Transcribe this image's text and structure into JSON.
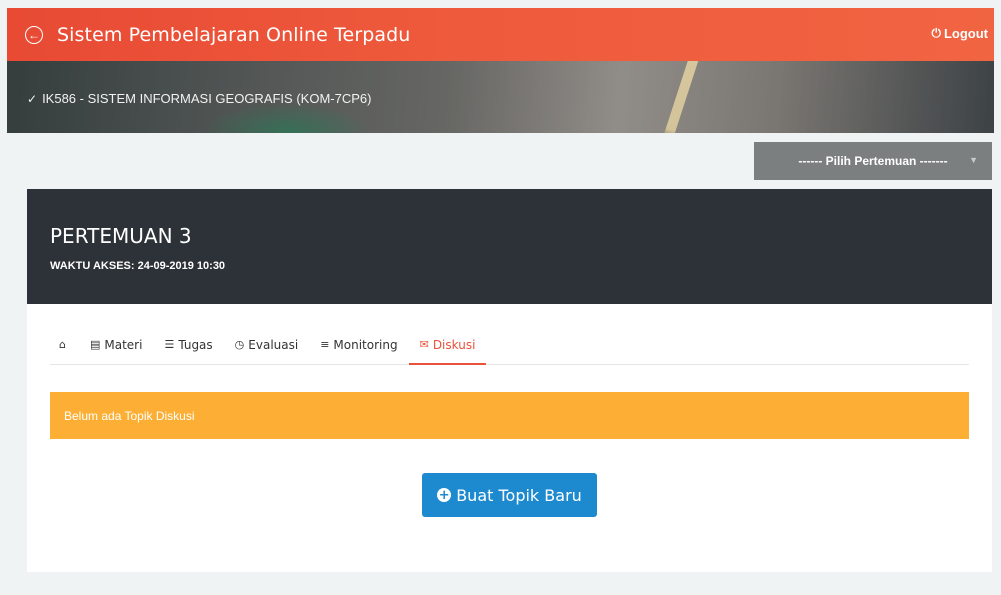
{
  "header": {
    "app_title": "Sistem Pembelajaran Online Terpadu",
    "back_icon": "circle-arrow-left-icon",
    "logout_label": "Logout",
    "logout_icon": "power-icon",
    "brand_color": "#ee5a3c"
  },
  "banner": {
    "course_title": "IK586 - SISTEM INFORMASI GEOGRAFIS (KOM-7CP6)",
    "course_icon": "check-circle-icon"
  },
  "meeting_select": {
    "selected": "------ Pilih Pertemuan -------"
  },
  "meeting": {
    "title": "PERTEMUAN 3",
    "access_time": "WAKTU AKSES: 24-09-2019 10:30"
  },
  "tabs": [
    {
      "label": "",
      "icon": "home-icon",
      "active": false
    },
    {
      "label": "Materi",
      "icon": "file-text-icon",
      "active": false
    },
    {
      "label": "Tugas",
      "icon": "tasks-icon",
      "active": false
    },
    {
      "label": "Evaluasi",
      "icon": "clock-icon",
      "active": false
    },
    {
      "label": "Monitoring",
      "icon": "list-icon",
      "active": false
    },
    {
      "label": "Diskusi",
      "icon": "comments-icon",
      "active": true
    }
  ],
  "discussion": {
    "empty_message": "Belum ada Topik Diskusi",
    "new_topic_button": "Buat Topik Baru",
    "new_topic_icon": "plus-circle-icon",
    "alert_color": "#fcaf34",
    "button_color": "#1d8ad0"
  }
}
